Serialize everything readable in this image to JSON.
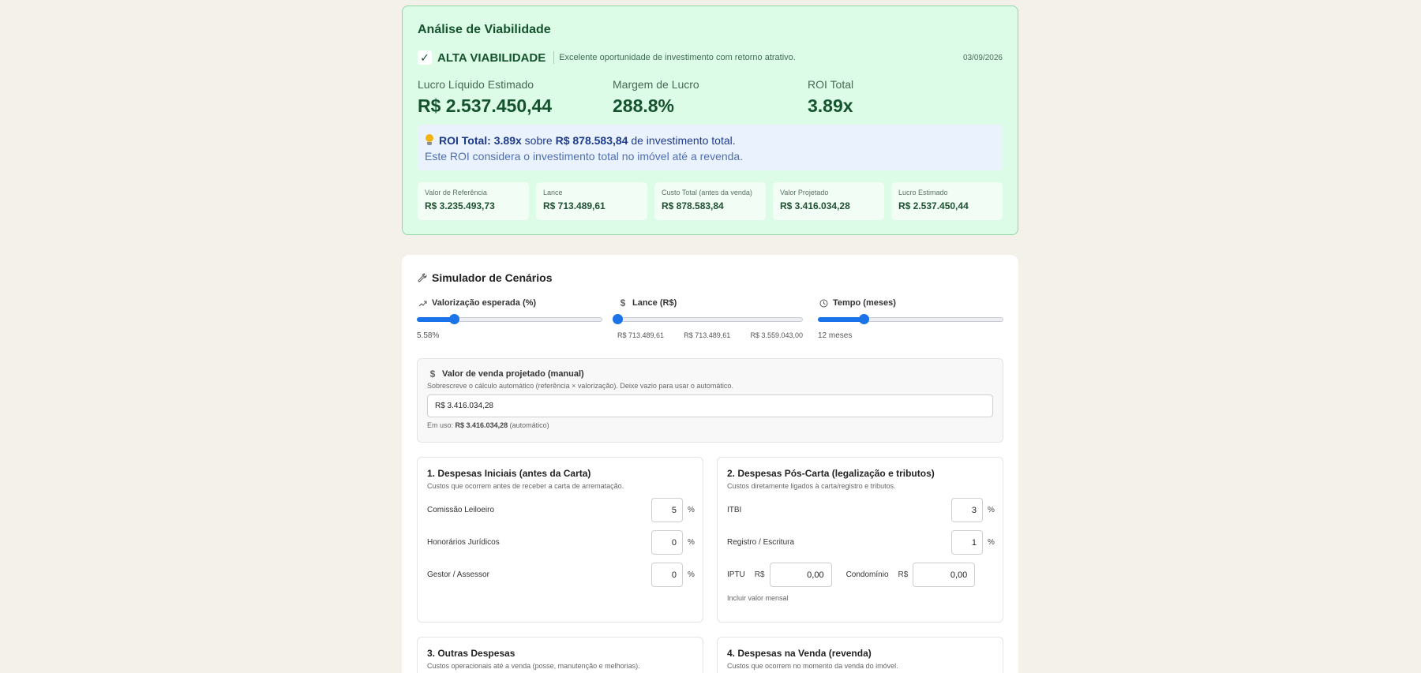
{
  "viability": {
    "title": "Análise de Viabilidade",
    "status_label": "ALTA VIABILIDADE",
    "status_desc": "Excelente oportunidade de investimento com retorno atrativo.",
    "date": "03/09/2026",
    "metrics": [
      {
        "label": "Lucro Líquido Estimado",
        "value": "R$ 2.537.450,44"
      },
      {
        "label": "Margem de Lucro",
        "value": "288.8%"
      },
      {
        "label": "ROI Total",
        "value": "3.89x"
      }
    ],
    "roi_note": {
      "prefix": "ROI Total:",
      "roi": "3.89x",
      "mid": "sobre",
      "amount": "R$ 878.583,84",
      "suffix": "de investimento total.",
      "line2": "Este ROI considera o investimento total no imóvel até a revenda."
    },
    "summary": [
      {
        "label": "Valor de Referência",
        "value": "R$ 3.235.493,73"
      },
      {
        "label": "Lance",
        "value": "R$ 713.489,61"
      },
      {
        "label": "Custo Total (antes da venda)",
        "value": "R$ 878.583,84"
      },
      {
        "label": "Valor Projetado",
        "value": "R$ 3.416.034,28"
      },
      {
        "label": "Lucro Estimado",
        "value": "R$ 2.537.450,44"
      }
    ]
  },
  "simulator": {
    "title": "Simulador de Cenários",
    "sliders": {
      "valorizacao": {
        "label": "Valorização esperada (%)",
        "value_text": "5.58%",
        "level": 0.2
      },
      "lance": {
        "label": "Lance (R$)",
        "min": "R$ 713.489,61",
        "current": "R$ 713.489,61",
        "max": "R$ 3.559.043,00",
        "level": 0.0
      },
      "tempo": {
        "label": "Tempo (meses)",
        "value_text": "12 meses",
        "level": 0.25
      }
    },
    "manual": {
      "label": "Valor de venda projetado (manual)",
      "help": "Sobrescreve o cálculo automático (referência × valorização). Deixe vazio para usar o automático.",
      "value": "R$ 3.416.034,28",
      "in_use_prefix": "Em uso:",
      "in_use_value": "R$ 3.416.034,28",
      "in_use_suffix": "(automático)"
    },
    "section1": {
      "title": "1. Despesas Iniciais (antes da Carta)",
      "subtitle": "Custos que ocorrem antes de receber a carta de arrematação.",
      "fields": [
        {
          "label": "Comissão Leiloeiro",
          "value": "5",
          "unit": "%"
        },
        {
          "label": "Honorários Jurídicos",
          "value": "0",
          "unit": "%"
        },
        {
          "label": "Gestor / Assessor",
          "value": "0",
          "unit": "%"
        }
      ]
    },
    "section2": {
      "title": "2. Despesas Pós-Carta (legalização e tributos)",
      "subtitle": "Custos diretamente ligados à carta/registro e tributos.",
      "fields": [
        {
          "label": "ITBI",
          "value": "3",
          "unit": "%"
        },
        {
          "label": "Registro / Escritura",
          "value": "1",
          "unit": "%"
        }
      ],
      "iptu": {
        "label": "IPTU",
        "currency": "R$",
        "value": "0,00"
      },
      "condominio": {
        "label": "Condomínio",
        "currency": "R$",
        "value": "0,00"
      },
      "monthly_note": "Incluir valor mensal"
    },
    "section3": {
      "title": "3. Outras Despesas",
      "subtitle": "Custos operacionais até a venda (posse, manutenção e melhorias)."
    },
    "section4": {
      "title": "4. Despesas na Venda (revenda)",
      "subtitle": "Custos que ocorrem no momento da venda do imóvel."
    }
  }
}
